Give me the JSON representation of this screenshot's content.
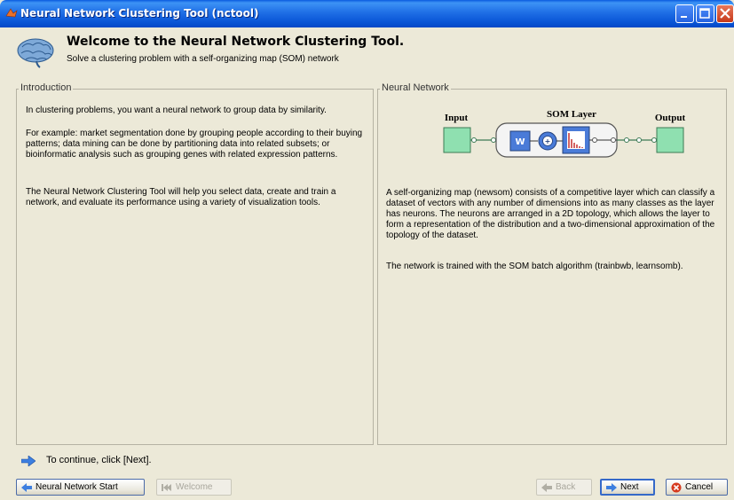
{
  "window": {
    "title": "Neural Network Clustering Tool (nctool)"
  },
  "header": {
    "title": "Welcome to the Neural Network Clustering Tool.",
    "subtitle": "Solve a clustering problem with a self-organizing map (SOM) network"
  },
  "introduction": {
    "legend": "Introduction",
    "paragraphs": [
      "In clustering problems, you want a neural network to group data by similarity.",
      "For example: market segmentation done by grouping people according to their buying patterns; data mining can be done by partitioning data into related subsets; or bioinformatic analysis such as grouping genes with related expression patterns.",
      "The Neural Network Clustering Tool will help you select data, create and train a network, and evaluate its performance using a variety of visualization tools."
    ]
  },
  "neural_network": {
    "legend": "Neural Network",
    "diagram": {
      "input_label": "Input",
      "layer_label": "SOM Layer",
      "output_label": "Output",
      "weight_label": "W",
      "sum_label": "+"
    },
    "paragraphs": [
      "A self-organizing map (newsom) consists of a competitive layer which can classify a dataset of vectors with any number of dimensions into as many classes as the layer has neurons. The neurons are arranged in a 2D topology, which allows the layer to form a representation of the distribution and a two-dimensional approximation of the topology of the dataset.",
      "The network is trained with the SOM batch algorithm (trainbwb, learnsomb)."
    ]
  },
  "footer": {
    "continue_text": "To continue, click [Next].",
    "buttons": {
      "start": "Neural Network Start",
      "welcome": "Welcome",
      "back": "Back",
      "next": "Next",
      "cancel": "Cancel"
    }
  },
  "colors": {
    "titlebar": "#0a55d6",
    "panel_border": "#b5b2a3",
    "window_bg": "#ece9d8",
    "node_green": "#8fe0b0",
    "node_blue": "#4a7bd8"
  },
  "icons": [
    "matlab-icon",
    "brain-icon",
    "arrow-right-icon",
    "start-icon",
    "first-icon",
    "back-arrow-icon",
    "next-arrow-icon",
    "cancel-icon"
  ]
}
